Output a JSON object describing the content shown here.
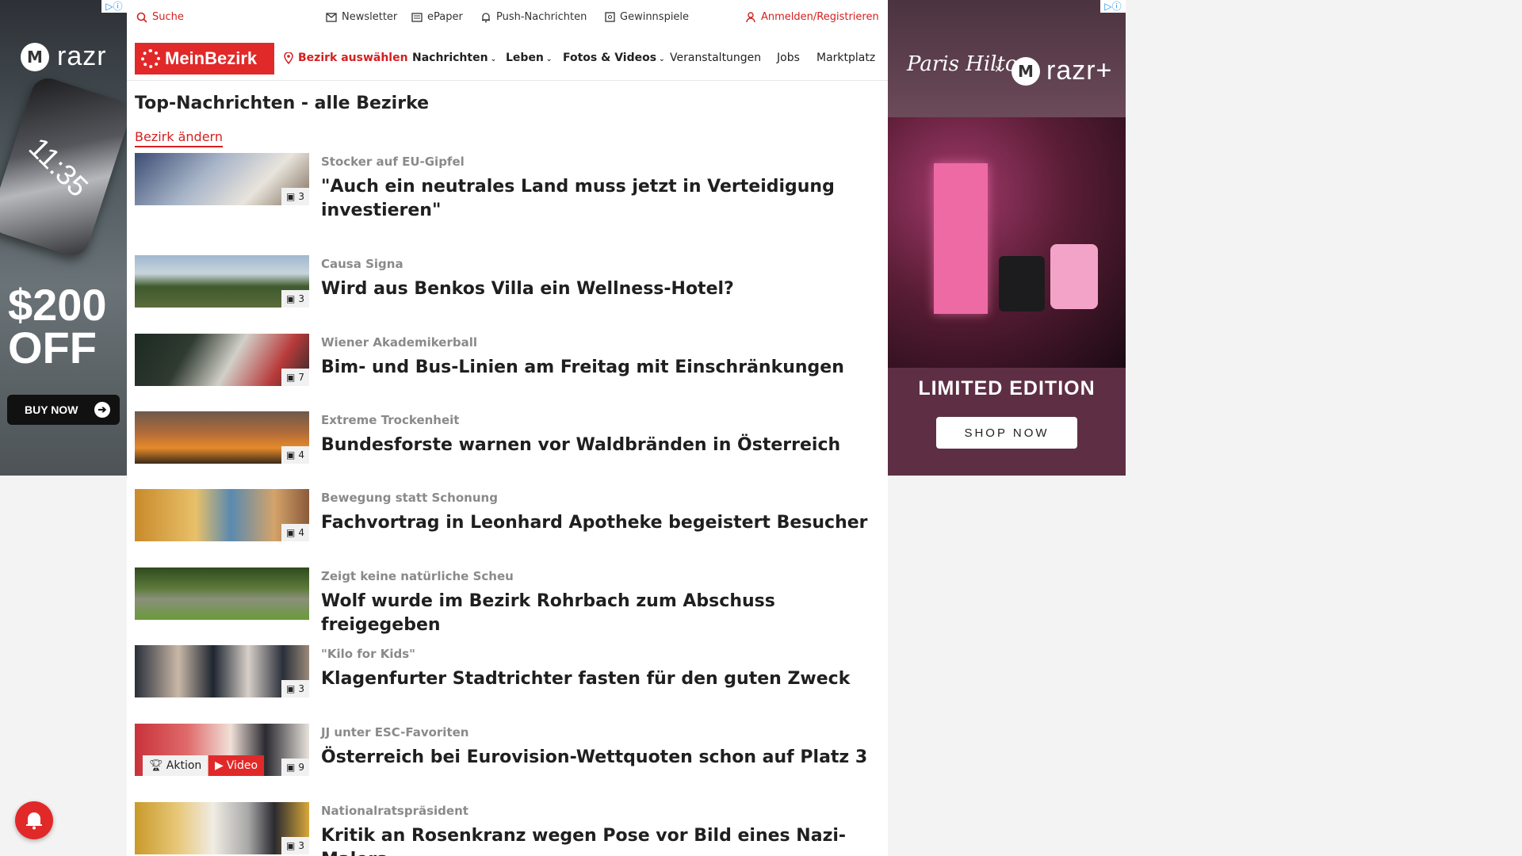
{
  "ads": {
    "badge": "▷ⓘ",
    "left": {
      "brand": "razr",
      "phone_time": "11:35",
      "offer_line1": "$200",
      "offer_line2": "OFF",
      "cta": "BUY NOW"
    },
    "right": {
      "signature": "Paris Hilton",
      "times": "×",
      "brand": "razr+",
      "headline": "LIMITED EDITION",
      "cta": "SHOP NOW"
    }
  },
  "utility": {
    "search": "Suche",
    "newsletter": "Newsletter",
    "epaper": "ePaper",
    "push": "Push-Nachrichten",
    "gewinnspiele": "Gewinnspiele",
    "login": "Anmelden/Registrieren"
  },
  "nav": {
    "logo": "MeinBezirk",
    "bezirk": "Bezirk auswählen",
    "items": [
      "Nachrichten",
      "Leben",
      "Fotos & Videos",
      "Veranstaltungen",
      "Jobs",
      "Marktplatz"
    ]
  },
  "page": {
    "title": "Top-Nachrichten - alle Bezirke",
    "change_link": "Bezirk ändern"
  },
  "articles": [
    {
      "kicker": "Stocker auf EU-Gipfel",
      "headline": "\"Auch ein neutrales Land muss jetzt in Verteidigung investieren\"",
      "photos": "3"
    },
    {
      "kicker": "Causa Signa",
      "headline": "Wird aus Benkos Villa ein Wellness-Hotel?",
      "photos": "3"
    },
    {
      "kicker": "Wiener Akademikerball",
      "headline": "Bim- und Bus-Linien am Freitag mit Einschränkungen",
      "photos": "7"
    },
    {
      "kicker": "Extreme Trockenheit",
      "headline": "Bundesforste warnen vor Waldbränden in Österreich",
      "photos": "4"
    },
    {
      "kicker": "Bewegung statt Schonung",
      "headline": "Fachvortrag in Leonhard Apotheke begeistert Besucher",
      "photos": "4"
    },
    {
      "kicker": "Zeigt keine natürliche Scheu",
      "headline": "Wolf wurde im Bezirk Rohrbach zum Abschuss freigegeben",
      "photos": ""
    },
    {
      "kicker": "\"Kilo for Kids\"",
      "headline": "Klagenfurter Stadtrichter fasten für den guten Zweck",
      "photos": "3"
    },
    {
      "kicker": "JJ unter ESC-Favoriten",
      "headline": "Österreich bei Eurovision-Wettquoten schon auf Platz 3",
      "photos": "9",
      "tag_aktion": "Aktion",
      "tag_video": "Video"
    },
    {
      "kicker": "Nationalratspräsident",
      "headline": "Kritik an Rosenkranz wegen Pose vor Bild eines Nazi-Malers",
      "photos": "3"
    }
  ]
}
